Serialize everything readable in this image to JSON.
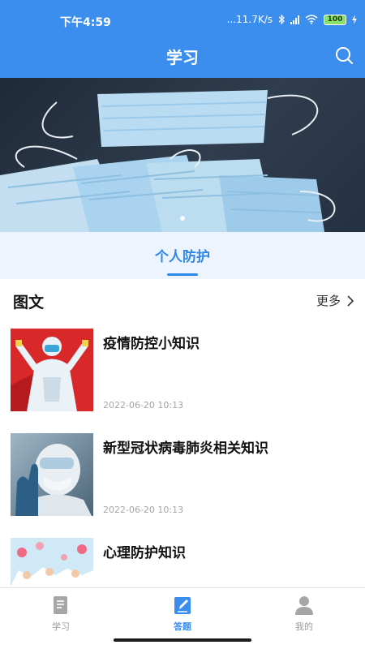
{
  "status_bar": {
    "time": "下午4:59",
    "network_speed": "...11.7K/s",
    "battery": "100",
    "icons": [
      "bluetooth-icon",
      "hd-signal-icon",
      "wifi-icon",
      "battery-icon",
      "charging-icon"
    ]
  },
  "header": {
    "title": "学习",
    "search_icon": "search-icon"
  },
  "banner": {
    "subject": "surgical-masks-photo",
    "slide_count": 1
  },
  "category": {
    "active_tab": "个人防护"
  },
  "section": {
    "title": "图文",
    "more_label": "更多"
  },
  "articles": [
    {
      "title": "疫情防控小知识",
      "date": "2022-06-20 10:13"
    },
    {
      "title": "新型冠状病毒肺炎相关知识",
      "date": "2022-06-20 10:13"
    },
    {
      "title": "心理防护知识",
      "date": ""
    }
  ],
  "bottom_nav": [
    {
      "label": "学习",
      "icon": "book-icon",
      "active": false
    },
    {
      "label": "答题",
      "icon": "edit-icon",
      "active": true
    },
    {
      "label": "我的",
      "icon": "user-icon",
      "active": false
    }
  ],
  "colors": {
    "primary": "#3c8eee",
    "accent_text": "#2f86ea",
    "category_bg": "#eef4fd",
    "date_text": "#a5a5a5"
  }
}
